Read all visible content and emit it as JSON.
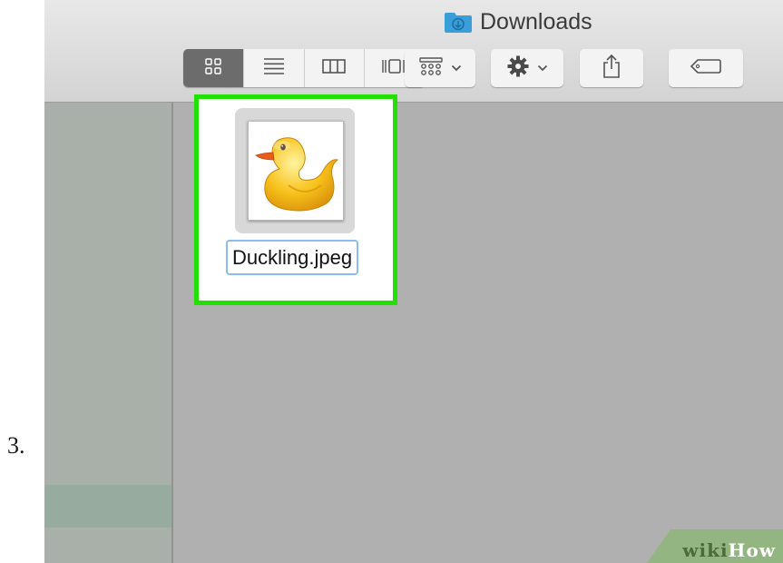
{
  "step": {
    "number": "3."
  },
  "window": {
    "title": "Downloads",
    "title_icon": "folder-icon"
  },
  "toolbar": {
    "view_buttons": [
      {
        "icon": "icon-view-icon",
        "active": true
      },
      {
        "icon": "list-view-icon",
        "active": false
      },
      {
        "icon": "column-view-icon",
        "active": false
      },
      {
        "icon": "cover-flow-icon",
        "active": false
      }
    ],
    "arrange_icon": "arrange-icon",
    "action_icon": "gear-icon",
    "share_icon": "share-icon",
    "tag_icon": "tag-icon"
  },
  "content": {
    "file": {
      "name": "Duckling.jpeg",
      "thumbnail": "duckling-thumbnail",
      "selected": true
    }
  },
  "watermark": {
    "part1": "wiki",
    "part2": "How"
  },
  "colors": {
    "highlight": "#22e000",
    "selection_border": "#8cbcf0",
    "sidebar_selected": "#98ab9f",
    "folder_blue": "#3a9fd8"
  }
}
